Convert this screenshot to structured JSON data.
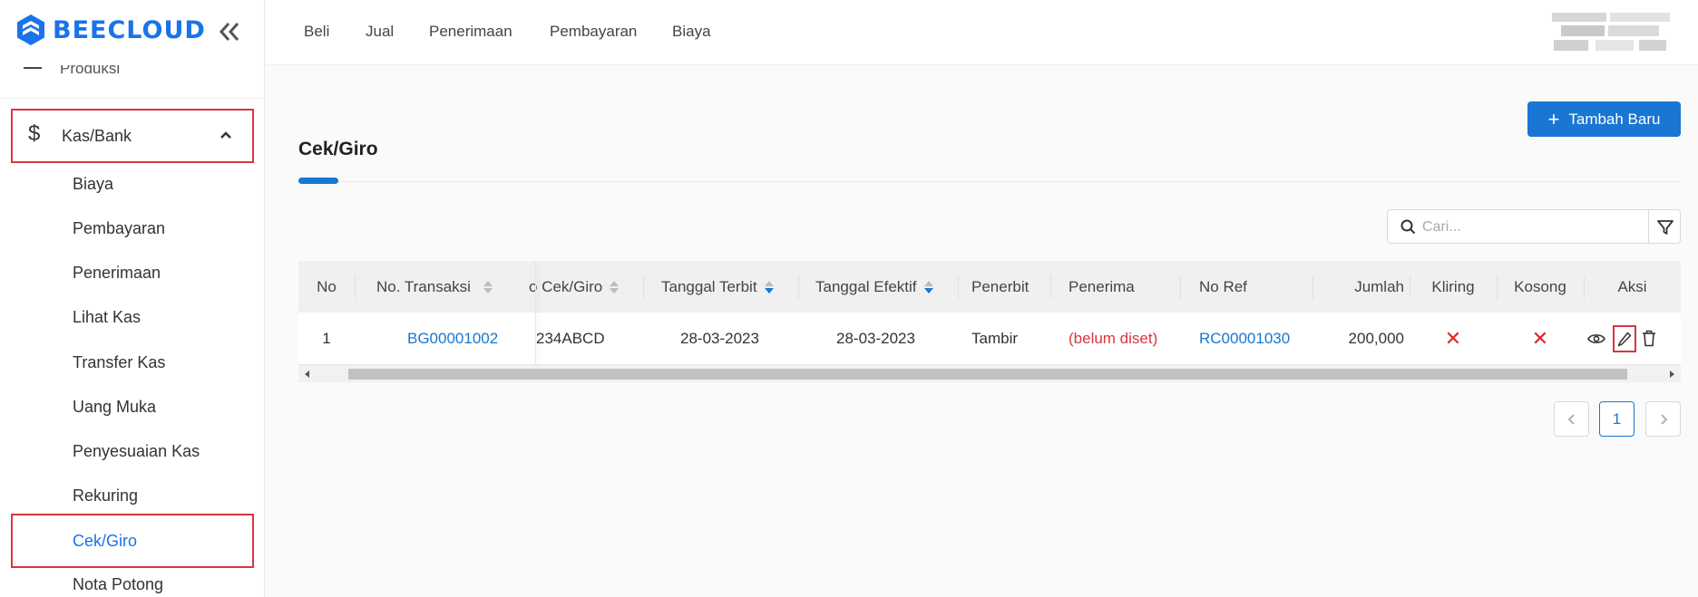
{
  "app": {
    "brand": "BEECLOUD",
    "accent": "#1976d2",
    "alert": "#d9363e"
  },
  "sidebar": {
    "partial_item": "Produksi",
    "parent": {
      "label": "Kas/Bank",
      "icon": "dollar-icon",
      "expanded": true
    },
    "items": [
      {
        "label": "Biaya"
      },
      {
        "label": "Pembayaran"
      },
      {
        "label": "Penerimaan"
      },
      {
        "label": "Lihat Kas"
      },
      {
        "label": "Transfer Kas"
      },
      {
        "label": "Uang Muka"
      },
      {
        "label": "Penyesuaian Kas"
      },
      {
        "label": "Rekuring"
      },
      {
        "label": "Cek/Giro",
        "active": true
      },
      {
        "label": "Nota Potong"
      }
    ]
  },
  "topnav": {
    "items": [
      "Beli",
      "Jual",
      "Penerimaan",
      "Pembayaran",
      "Biaya"
    ]
  },
  "main": {
    "add_button": "Tambah Baru",
    "title": "Cek/Giro",
    "search_placeholder": "Cari..."
  },
  "table": {
    "columns": [
      "No",
      "No. Transaksi",
      "No Cek/Giro",
      "Tanggal Terbit",
      "Tanggal Efektif",
      "Penerbit",
      "Penerima",
      "No Ref",
      "Jumlah",
      "Kliring",
      "Kosong",
      "Aksi"
    ],
    "column_visible_text": {
      "no_cek": "o Cek/Giro"
    },
    "rows": [
      {
        "no": "1",
        "transaksi": "BG00001002",
        "cek_visible": "234ABCD",
        "terbit": "28-03-2023",
        "efektif": "28-03-2023",
        "penerbit": "Tambir",
        "penerima": "(belum diset)",
        "ref": "RC00001030",
        "jumlah": "200,000",
        "kliring": "✕",
        "kosong": "✕"
      }
    ]
  },
  "pagination": {
    "current": "1"
  }
}
